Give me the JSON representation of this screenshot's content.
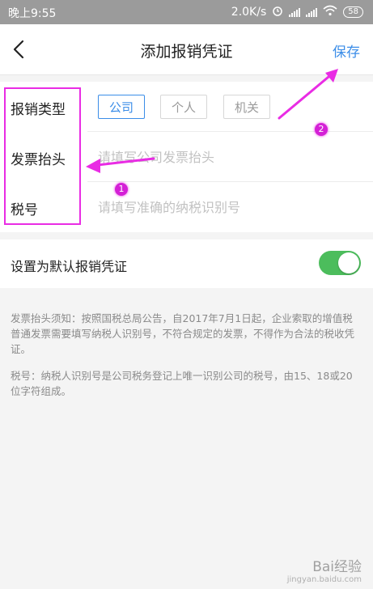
{
  "status_bar": {
    "time": "晚上9:55",
    "speed": "2.0K/s",
    "battery": "58"
  },
  "header": {
    "title": "添加报销凭证",
    "save_label": "保存"
  },
  "form": {
    "type_label": "报销类型",
    "type_options": [
      "公司",
      "个人",
      "机关"
    ],
    "selected_option": "公司",
    "invoice_title_label": "发票抬头",
    "invoice_title_placeholder": "请填写公司发票抬头",
    "invoice_title_value": "",
    "tax_id_label": "税号",
    "tax_id_placeholder": "请填写准确的纳税识别号",
    "tax_id_value": ""
  },
  "default_setting": {
    "label": "设置为默认报销凭证",
    "enabled": true
  },
  "notes": {
    "invoice_note": "发票抬头须知：按照国税总局公告，自2017年7月1日起，企业索取的增值税普通发票需要填写纳税人识别号，不符合规定的发票，不得作为合法的税收凭证。",
    "tax_note": "税号：纳税人识别号是公司税务登记上唯一识别公司的税号，由15、18或20位字符组成。"
  },
  "annotations": {
    "marker_1": "1",
    "marker_2": "2"
  },
  "watermark": {
    "brand": "Bai经验",
    "url": "jingyan.baidu.com"
  },
  "colors": {
    "accent": "#3b8de8",
    "toggle_on": "#4cbd5c",
    "annotation": "#e92ce4",
    "status_bar": "#9b9b9b"
  }
}
